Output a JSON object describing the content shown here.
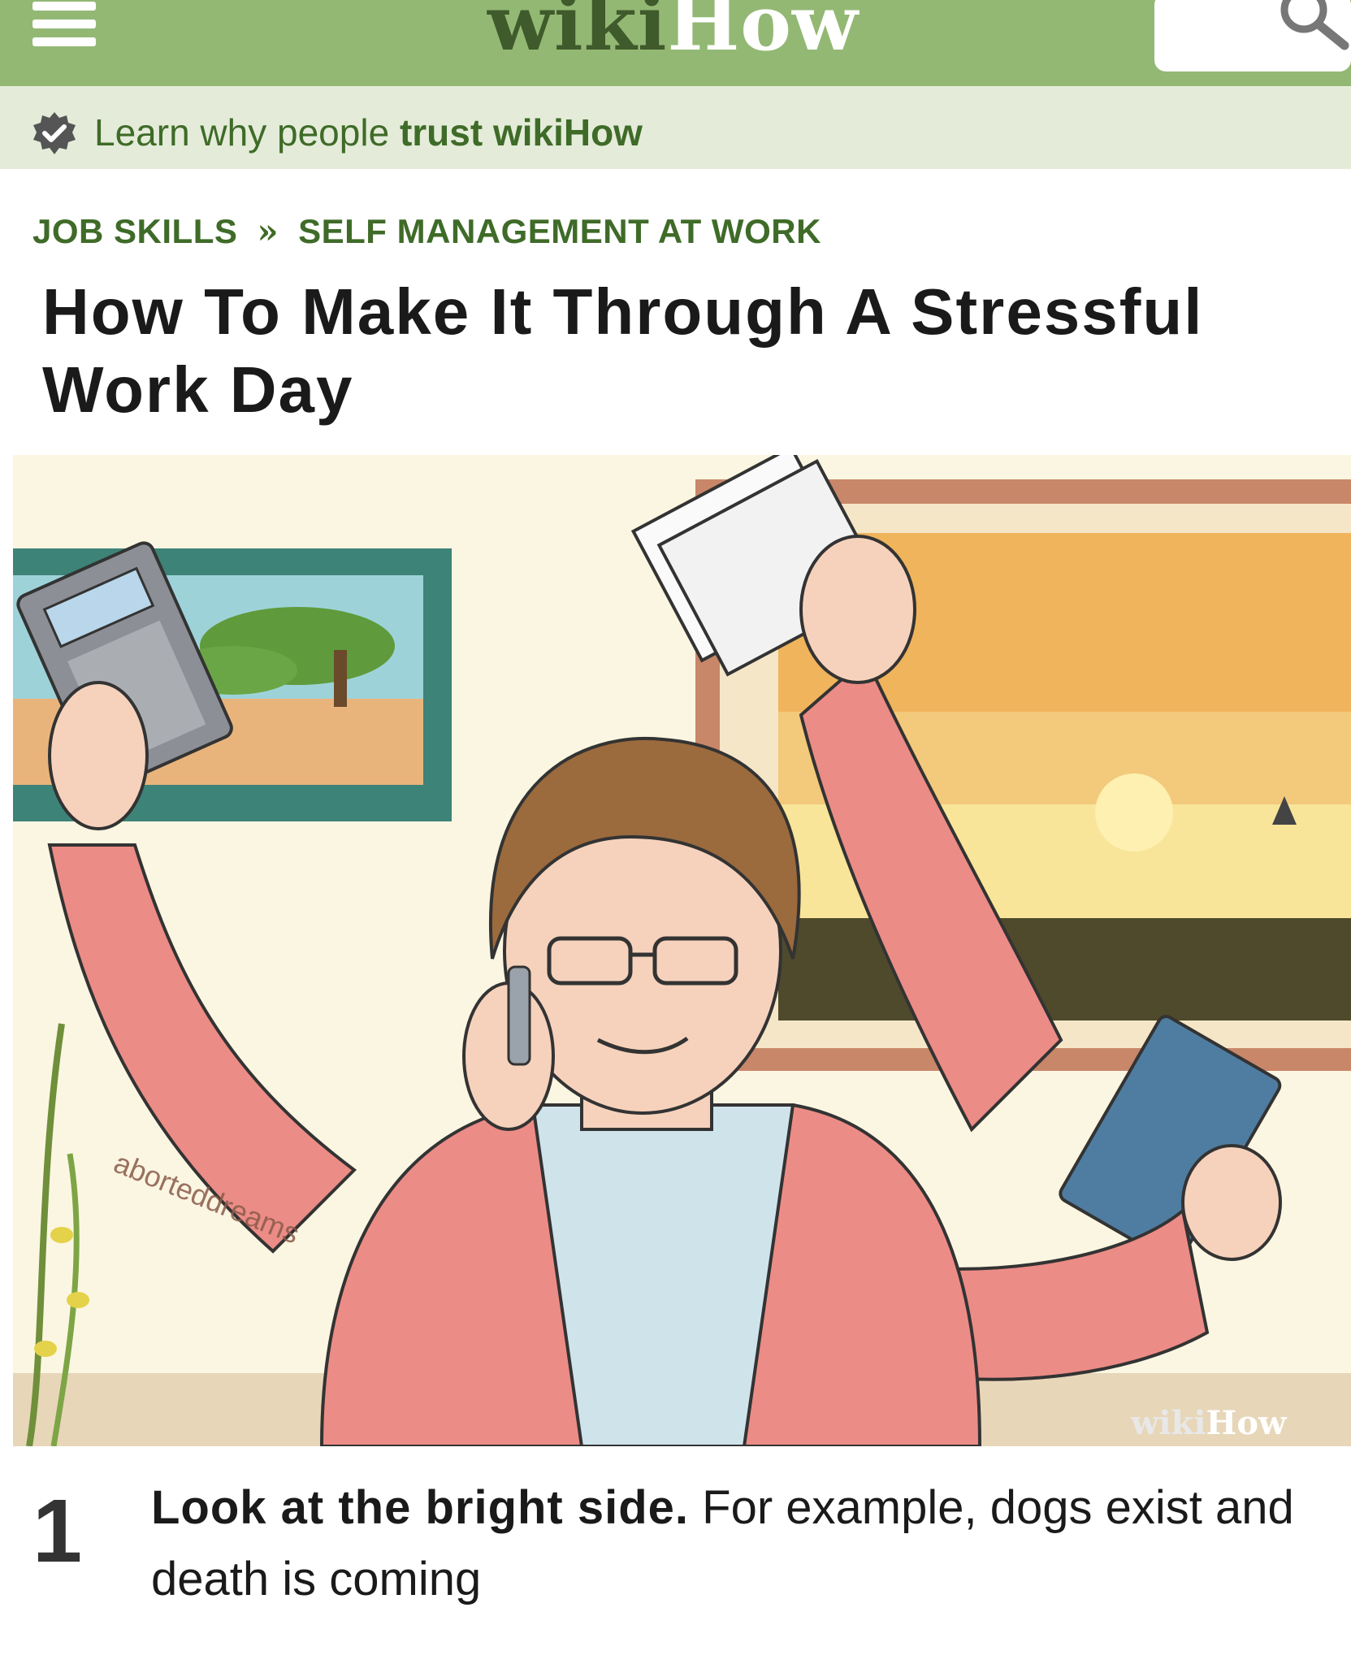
{
  "header": {
    "menu_icon": "hamburger-menu-icon",
    "logo_part1": "wiki",
    "logo_part2": "How",
    "search_icon": "search-icon",
    "brand_color": "#93b874"
  },
  "trust_banner": {
    "icon": "verified-badge-icon",
    "text_prefix": "Learn why people ",
    "text_bold": "trust wikiHow"
  },
  "breadcrumb": {
    "items": [
      "JOB SKILLS",
      "SELF MANAGEMENT AT WORK"
    ],
    "separator": "»"
  },
  "article": {
    "title": "How To Make It Through A Stressful Work Day"
  },
  "illustration": {
    "watermark_user": "aborteddreams",
    "logo_part1": "wiki",
    "logo_part2": "How"
  },
  "step": {
    "number": "1",
    "bold_text": "Look at the bright side.",
    "body_text": " For example, dogs exist and death is coming"
  }
}
